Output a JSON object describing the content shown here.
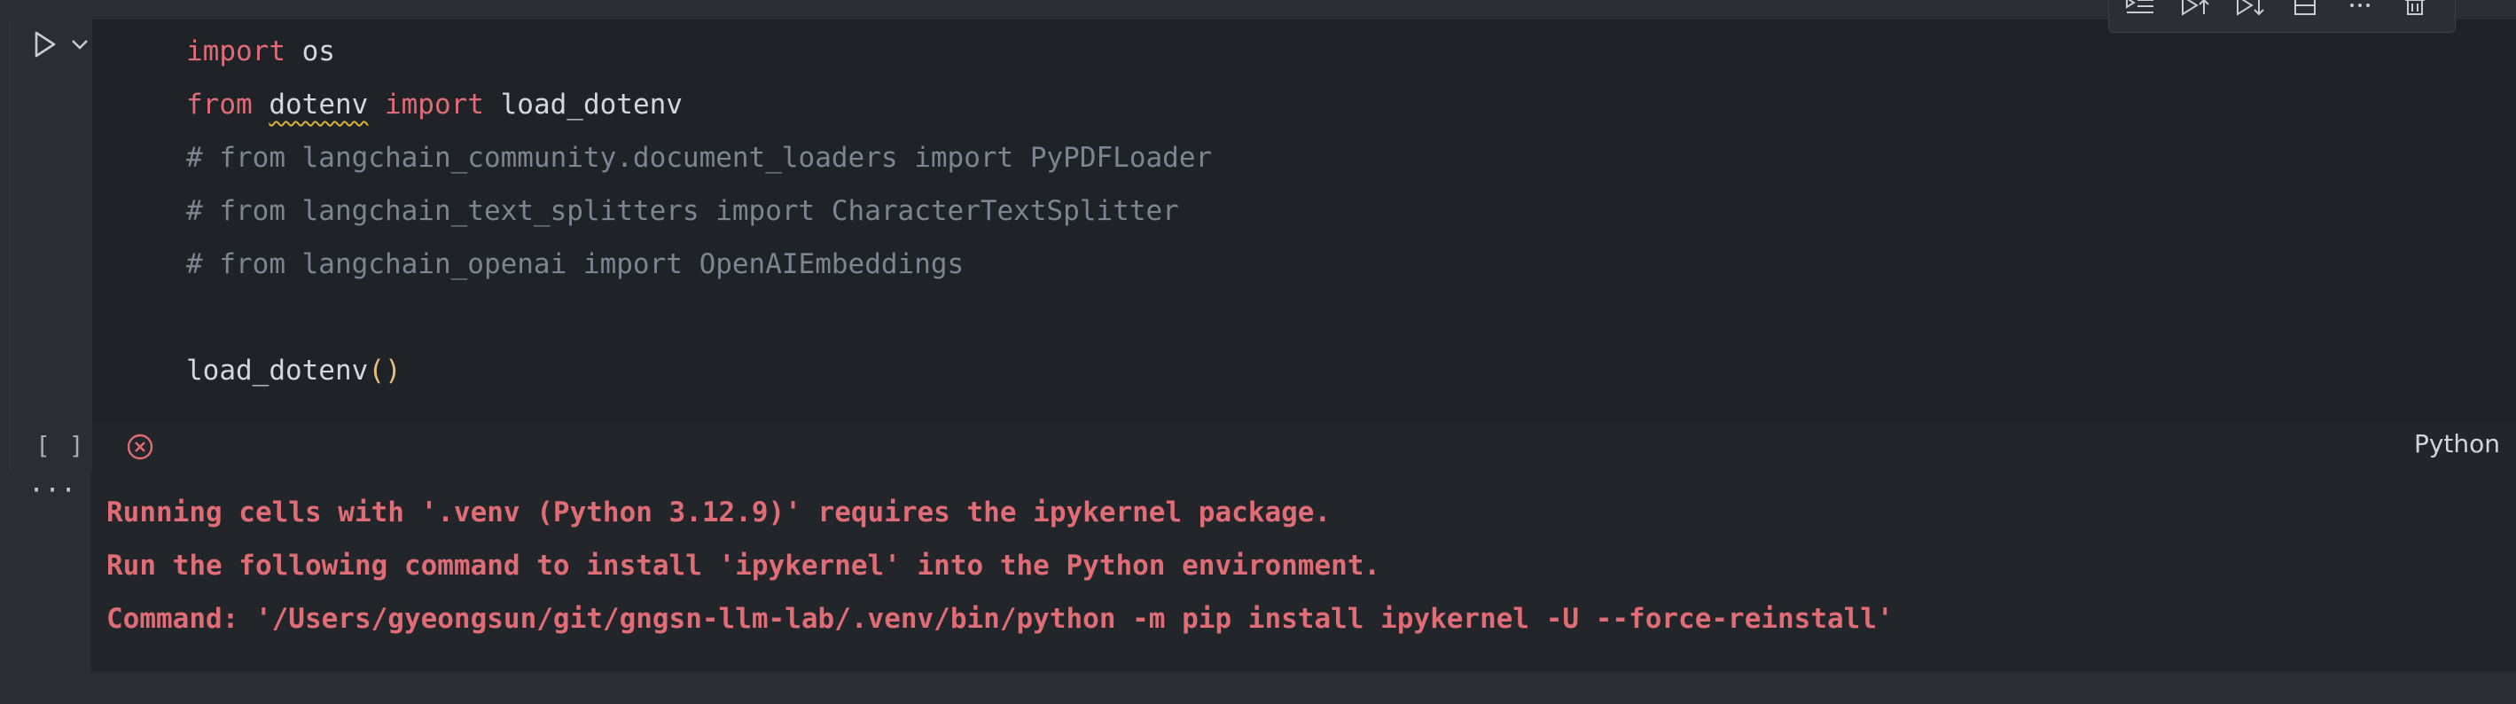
{
  "cell": {
    "code_lines": [
      {
        "kw1": "import",
        "rest": " os"
      },
      {
        "kw1": "from",
        "module": "dotenv",
        "kw2": "import",
        "name": "load_dotenv"
      },
      {
        "comment": "# from langchain_community.document_loaders import PyPDFLoader"
      },
      {
        "comment": "# from langchain_text_splitters import CharacterTextSplitter"
      },
      {
        "comment": "# from langchain_openai import OpenAIEmbeddings"
      },
      {
        "call": "load_dotenv",
        "parens": "()"
      }
    ],
    "execution_count": "[ ]",
    "language": "Python"
  },
  "icons": {
    "run": "play-icon",
    "chevron": "chevron-down-icon",
    "error": "error-circle-icon",
    "more": "more-icon"
  },
  "output": {
    "more_label": "···",
    "lines": [
      "Running cells with '.venv (Python 3.12.9)' requires the ipykernel package.",
      "Run the following command to install 'ipykernel' into the Python environment.",
      "Command: '/Users/gyeongsun/git/gngsn-llm-lab/.venv/bin/python -m pip install ipykernel -U --force-reinstall'"
    ]
  },
  "colors": {
    "background": "#2a2d33",
    "editor": "#1f2227",
    "keyword": "#e06c75",
    "comment": "#7f848e",
    "error_text": "#e06c75"
  }
}
